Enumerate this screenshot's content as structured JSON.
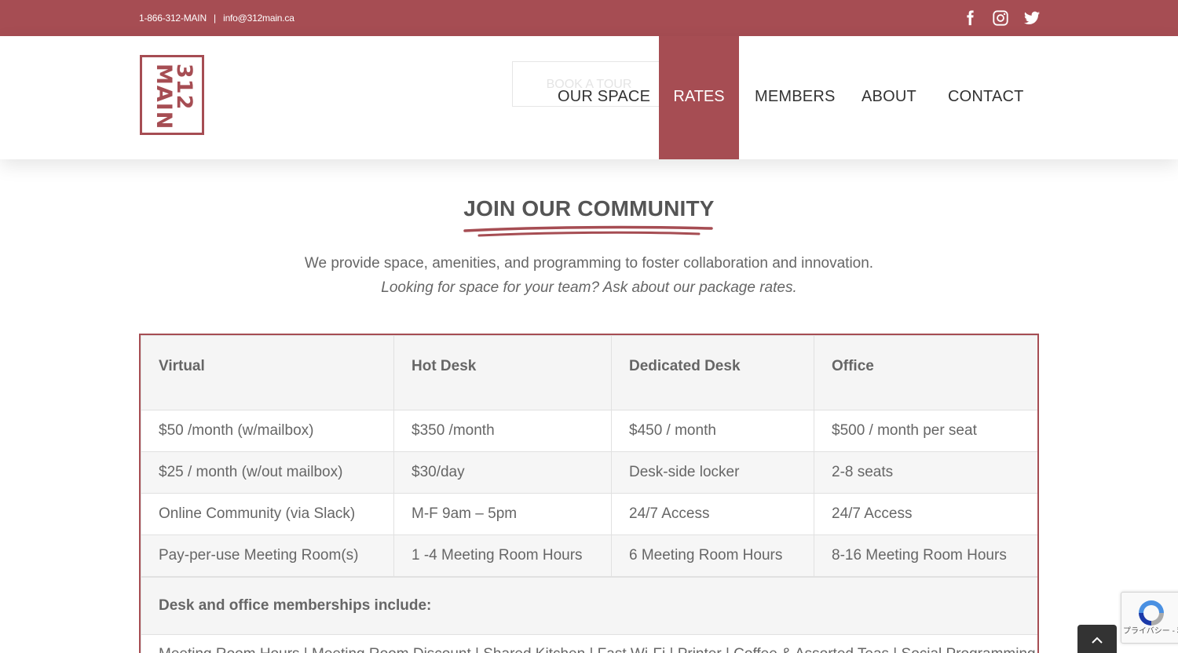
{
  "topbar": {
    "phone": "1-866-312-MAIN",
    "separator": "|",
    "email": "info@312main.ca",
    "social": [
      "facebook-icon",
      "instagram-icon",
      "twitter-icon"
    ]
  },
  "logo": {
    "line1": "312",
    "line2": "MAIN"
  },
  "header": {
    "book_tour": "BOOK A TOUR",
    "nav": [
      "OUR SPACE",
      "RATES",
      "MEMBERS",
      "ABOUT",
      "CONTACT"
    ],
    "active": "RATES"
  },
  "main": {
    "title": "JOIN OUR COMMUNITY",
    "lead": "We provide space, amenities, and programming to foster collaboration and innovation.",
    "lead_italic": "Looking for space for your team? Ask about our package rates."
  },
  "rates_table": {
    "headers": [
      "Virtual",
      "Hot Desk",
      "Dedicated Desk",
      "Office"
    ],
    "rows": [
      [
        "$50 /month (w/mailbox)",
        "$350 /month",
        "$450 / month",
        "$500 / month per seat"
      ],
      [
        "$25 / month (w/out mailbox)",
        "$30/day",
        "Desk-side locker",
        "2-8 seats"
      ],
      [
        "Online Community  (via Slack)",
        "M-F 9am – 5pm",
        "24/7 Access",
        "24/7 Access"
      ],
      [
        "Pay-per-use Meeting Room(s)",
        "1 -4 Meeting Room Hours",
        "6 Meeting Room Hours",
        "8-16 Meeting Room Hours"
      ]
    ],
    "includes_title": "Desk and office memberships include:",
    "includes_list": "Meeting Room Hours | Meeting Room Discount | Shared Kitchen | Fast Wi-Fi | Printer | Coffee & Assorted Teas | Social Programming"
  },
  "recaptcha": {
    "text": "プライバシー - 利用規約"
  },
  "colors": {
    "brand": "#a64d53",
    "text": "#555555"
  }
}
